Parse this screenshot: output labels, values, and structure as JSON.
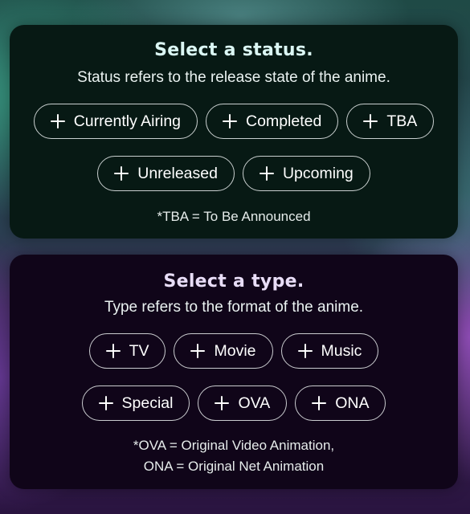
{
  "status_section": {
    "title": "Select a status.",
    "subtitle": "Status refers to the release state of the anime.",
    "options": [
      {
        "label": "Currently Airing",
        "icon": "plus-icon"
      },
      {
        "label": "Completed",
        "icon": "plus-icon"
      },
      {
        "label": "TBA",
        "icon": "plus-icon"
      },
      {
        "label": "Unreleased",
        "icon": "plus-icon"
      },
      {
        "label": "Upcoming",
        "icon": "plus-icon"
      }
    ],
    "footnote": "*TBA = To Be Announced"
  },
  "type_section": {
    "title": "Select a type.",
    "subtitle": "Type refers to the format of the anime.",
    "options": [
      {
        "label": "TV",
        "icon": "plus-icon"
      },
      {
        "label": "Movie",
        "icon": "plus-icon"
      },
      {
        "label": "Music",
        "icon": "plus-icon"
      },
      {
        "label": "Special",
        "icon": "plus-icon"
      },
      {
        "label": "OVA",
        "icon": "plus-icon"
      },
      {
        "label": "ONA",
        "icon": "plus-icon"
      }
    ],
    "footnote_line1": "*OVA = Original Video Animation,",
    "footnote_line2": "ONA = Original Net Animation"
  },
  "colors": {
    "status_card_bg": "#071914",
    "type_card_bg": "#100519",
    "chip_border": "#ebf0f0",
    "text": "#ffffff"
  }
}
